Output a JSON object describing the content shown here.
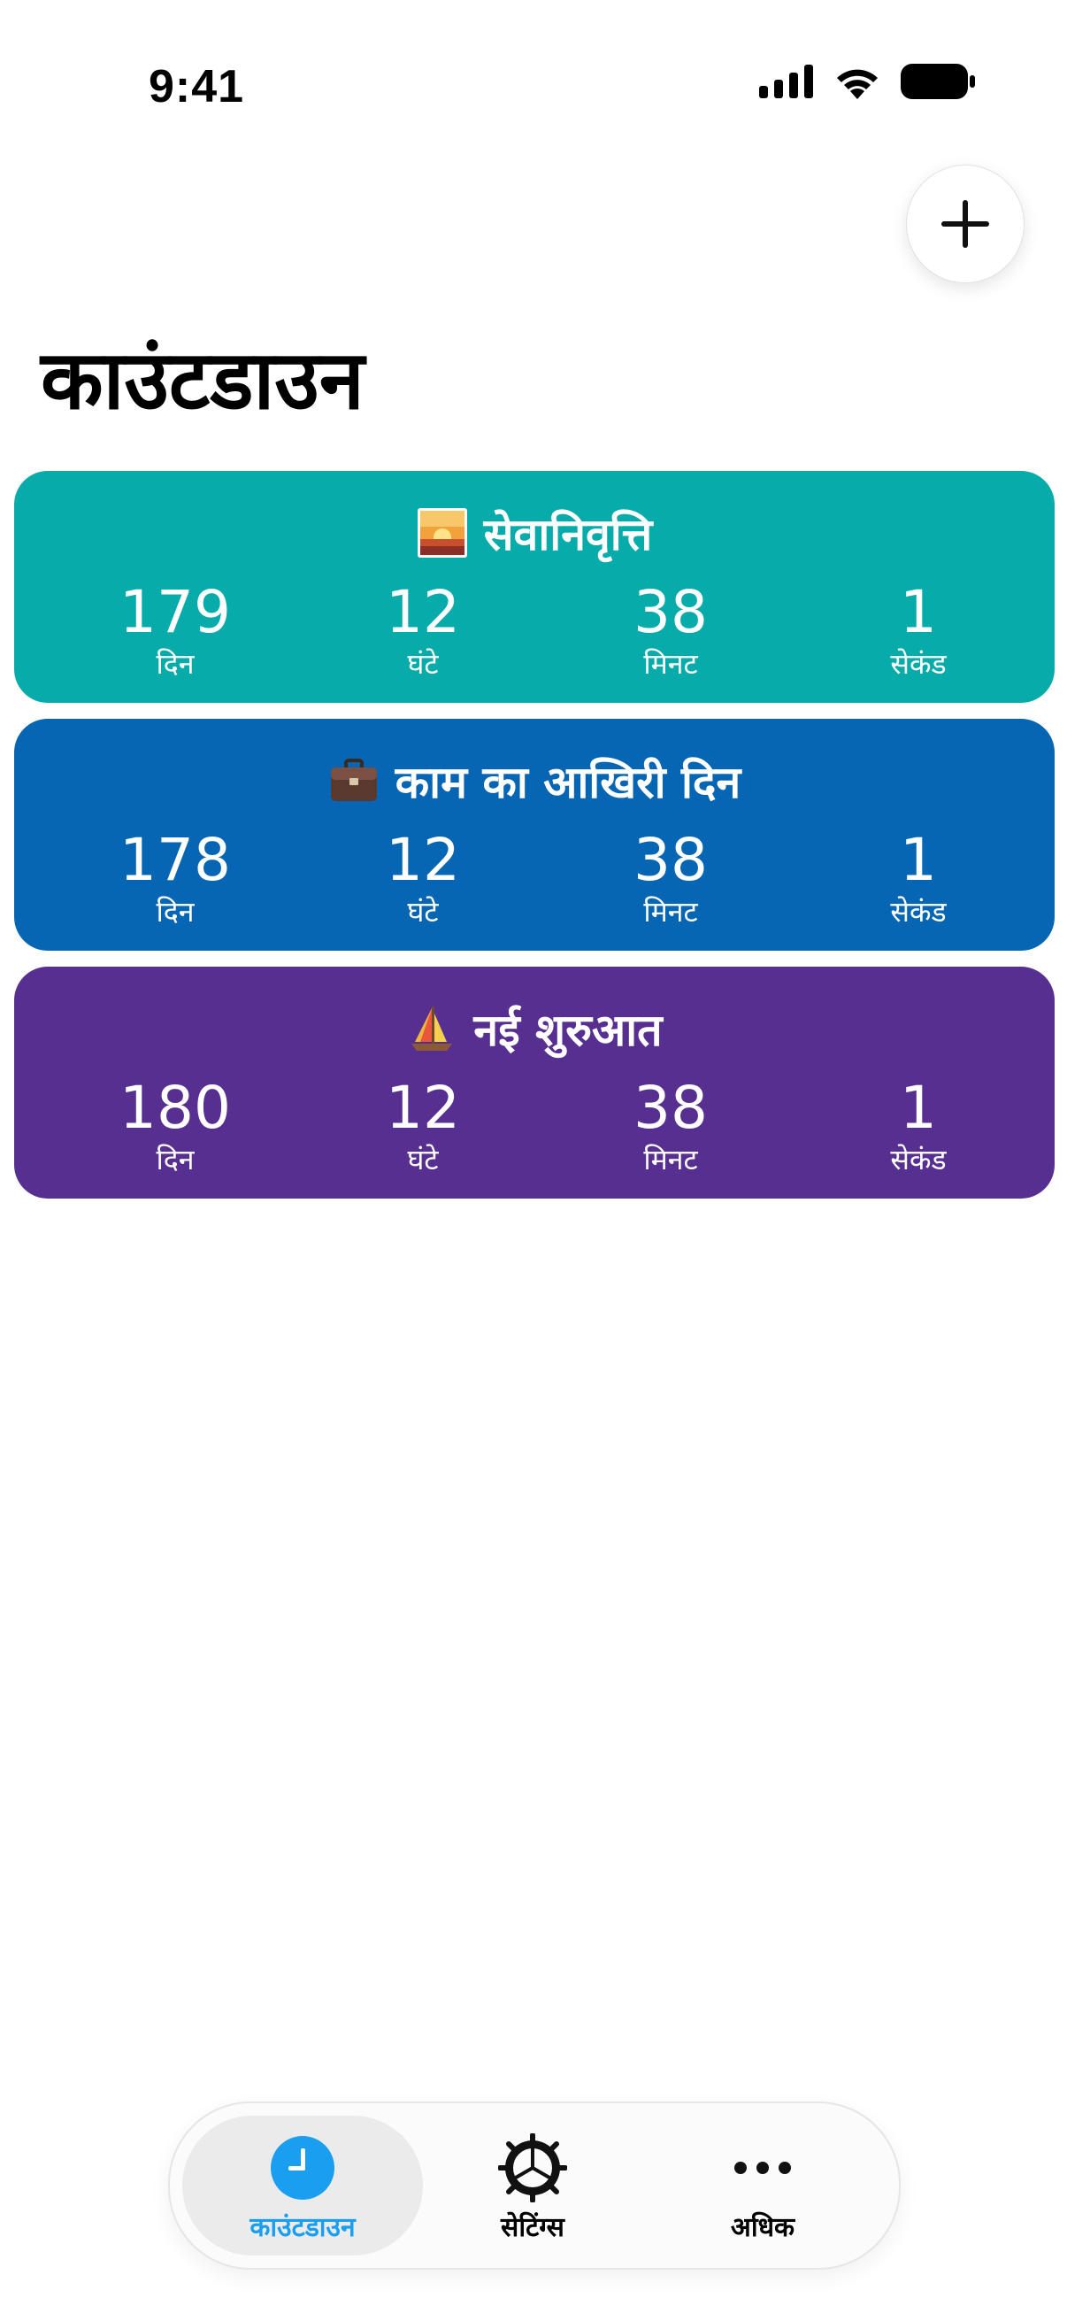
{
  "status_bar": {
    "time": "9:41",
    "icons": [
      "cellular-signal-icon",
      "wifi-icon",
      "battery-icon"
    ]
  },
  "header": {
    "title": "काउंटडाउन",
    "add_icon": "plus-icon"
  },
  "countdowns": [
    {
      "title": "सेवानिवृत्ति",
      "emoji": "sunrise",
      "color": "#07ACAA",
      "units": [
        {
          "value": "179",
          "label": "दिन"
        },
        {
          "value": "12",
          "label": "घंटे"
        },
        {
          "value": "38",
          "label": "मिनट"
        },
        {
          "value": "1",
          "label": "सेकंड"
        }
      ]
    },
    {
      "title": "काम का आखिरी दिन",
      "emoji": "briefcase",
      "color": "#0666B3",
      "units": [
        {
          "value": "178",
          "label": "दिन"
        },
        {
          "value": "12",
          "label": "घंटे"
        },
        {
          "value": "38",
          "label": "मिनट"
        },
        {
          "value": "1",
          "label": "सेकंड"
        }
      ]
    },
    {
      "title": "नई शुरुआत",
      "emoji": "sailboat",
      "color": "#572F91",
      "units": [
        {
          "value": "180",
          "label": "दिन"
        },
        {
          "value": "12",
          "label": "घंटे"
        },
        {
          "value": "38",
          "label": "मिनट"
        },
        {
          "value": "1",
          "label": "सेकंड"
        }
      ]
    }
  ],
  "tab_bar": {
    "tabs": [
      {
        "label": "काउंटडाउन",
        "icon": "clock-icon",
        "active": true
      },
      {
        "label": "सेटिंग्स",
        "icon": "gear-icon",
        "active": false
      },
      {
        "label": "अधिक",
        "icon": "more-dots-icon",
        "active": false
      }
    ],
    "accent": "#1A9EF0"
  }
}
